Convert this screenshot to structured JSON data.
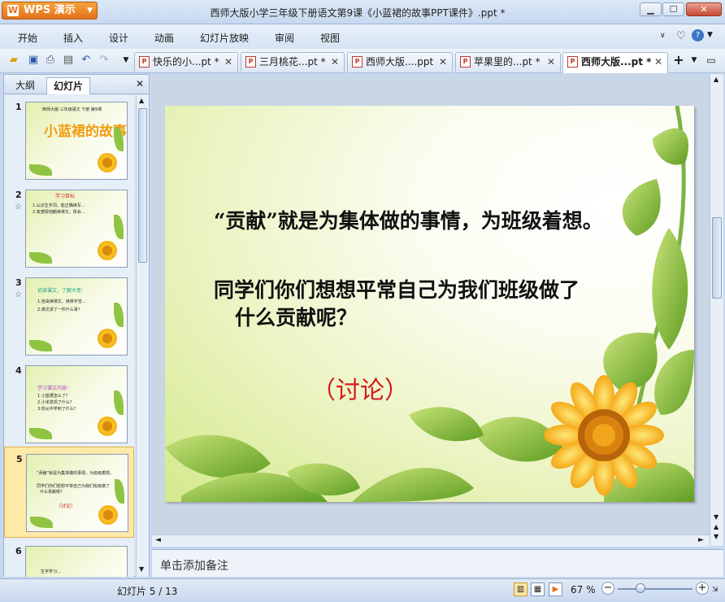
{
  "app": {
    "name": "WPS 演示",
    "window_title": "西师大版小学三年级下册语文第9课《小蓝裙的故事PPT课件》.ppt *"
  },
  "menu": [
    "开始",
    "插入",
    "设计",
    "动画",
    "幻灯片放映",
    "审阅",
    "视图"
  ],
  "doc_tabs": [
    {
      "label": "快乐的小...pt *"
    },
    {
      "label": "三月桃花...pt *"
    },
    {
      "label": "西师大版....ppt"
    },
    {
      "label": "苹果里的...pt *"
    },
    {
      "label": "西师大版...pt *"
    }
  ],
  "pane": {
    "tab_outline": "大纲",
    "tab_slides": "幻灯片",
    "close": "✕"
  },
  "thumbnails": [
    {
      "num": "1",
      "lines": [
        "西师大版 三年级语文 下册 第9课"
      ],
      "title": "小蓝裙的故事"
    },
    {
      "num": "2",
      "lines": [
        "学习目标",
        "1.认识生字词，能正确读写...",
        "2.有感情地朗读课文，体会..."
      ],
      "title": ""
    },
    {
      "num": "3",
      "lines": [
        "初读课文，了解大意：",
        "1.自由读课文，读准字音...",
        "2.课文讲了一件什么事？"
      ],
      "title": ""
    },
    {
      "num": "4",
      "lines": [
        "学习课文内容：",
        "1.小蓝裙怎么了？",
        "2.小米发现了什么？",
        "3.你从中学到了什么？"
      ],
      "title": ""
    },
    {
      "num": "5",
      "lines": [
        "“贡献”就是为集体做的事情，为班级着想。",
        "同学们你们想想平常自己为我们班级做了",
        "什么贡献呢？",
        "（讨论）"
      ],
      "title": ""
    },
    {
      "num": "6",
      "lines": [
        "生字学习..."
      ],
      "title": ""
    }
  ],
  "slide": {
    "line1": "“贡献”就是为集体做的事情，为班级着想。",
    "line2": "同学们你们想想平常自己为我们班级做了",
    "line3": "什么贡献呢？",
    "discuss": "（讨论）"
  },
  "notes_placeholder": "单击添加备注",
  "status": {
    "slide_counter": "幻灯片 5 / 13",
    "zoom": "67 %"
  },
  "colors": {
    "discuss": "#d41c1c",
    "accent": "#e3711a"
  }
}
